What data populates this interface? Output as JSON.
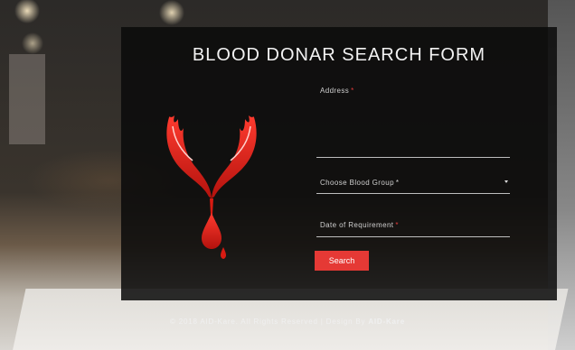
{
  "form": {
    "title": "BLOOD DONAR SEARCH FORM",
    "required_mark": "*",
    "address_label": "Address",
    "blood_group_label": "Choose Blood Group",
    "date_label": "Date of Requirement",
    "search_label": "Search"
  },
  "footer": {
    "copyright": "© 2018 AID-Kare. All Rights Reserved | Design By",
    "brand": "AID-Kare"
  },
  "colors": {
    "accent": "#e53935",
    "panel": "#0a0a0a"
  },
  "icons": {
    "logo": "hands-blood-drop-logo",
    "dropdown": "chevron-down-icon"
  }
}
